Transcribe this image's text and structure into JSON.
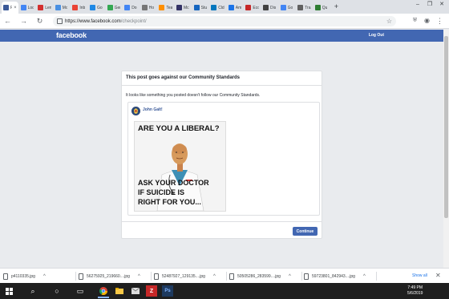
{
  "browser": {
    "tabs": [
      {
        "label": "Fa",
        "color": "#3b5998",
        "active": true
      },
      {
        "label": "Loc",
        "color": "#4285f4"
      },
      {
        "label": "Len",
        "color": "#d32f2f"
      },
      {
        "label": "Mc",
        "color": "#4a90e2"
      },
      {
        "label": "Inb",
        "color": "#ea4335"
      },
      {
        "label": "Go",
        "color": "#1e88e5"
      },
      {
        "label": "Ger",
        "color": "#34a853"
      },
      {
        "label": "Do",
        "color": "#4285f4"
      },
      {
        "label": "Ho",
        "color": "#777777"
      },
      {
        "label": "Tea",
        "color": "#ff8f00"
      },
      {
        "label": "Mc",
        "color": "#333366"
      },
      {
        "label": "Stu",
        "color": "#1565c0"
      },
      {
        "label": "Cld",
        "color": "#0277bd"
      },
      {
        "label": "Am",
        "color": "#1a73e8"
      },
      {
        "label": "Eco",
        "color": "#c62828"
      },
      {
        "label": "Dis",
        "color": "#424242"
      },
      {
        "label": "Go",
        "color": "#4285f4"
      },
      {
        "label": "Tra",
        "color": "#616161"
      },
      {
        "label": "Qu",
        "color": "#2e7d32"
      }
    ],
    "url_host": "https://www.facebook.com",
    "url_path": "/checkpoint/",
    "new_tab": "+",
    "window_controls": [
      "–",
      "❐",
      "✕"
    ]
  },
  "facebook": {
    "logo": "facebook",
    "logout": "Log Out"
  },
  "card": {
    "title": "This post goes against our Community Standards",
    "description": "It looks like something you posted doesn't follow our Community Standards.",
    "author": "John Galt!",
    "meme_top": "ARE YOU A LIBERAL?",
    "meme_bottom_1": "ASK YOUR DOCTOR",
    "meme_bottom_2": "IF SUICIDE IS",
    "meme_bottom_3": "RIGHT FOR YOU...",
    "continue_label": "Continue"
  },
  "downloads": {
    "items": [
      "p4110335.jpg",
      "56275925_219660....jpg",
      "52487927_129135....jpg",
      "50505286_283599....jpg",
      "59723801_842943....jpg"
    ],
    "show_all": "Show all"
  },
  "taskbar": {
    "time": "7:49 PM",
    "date": "5/6/2019"
  },
  "colors": {
    "fb_blue": "#4267b2",
    "page_bg": "#e9ebee"
  }
}
